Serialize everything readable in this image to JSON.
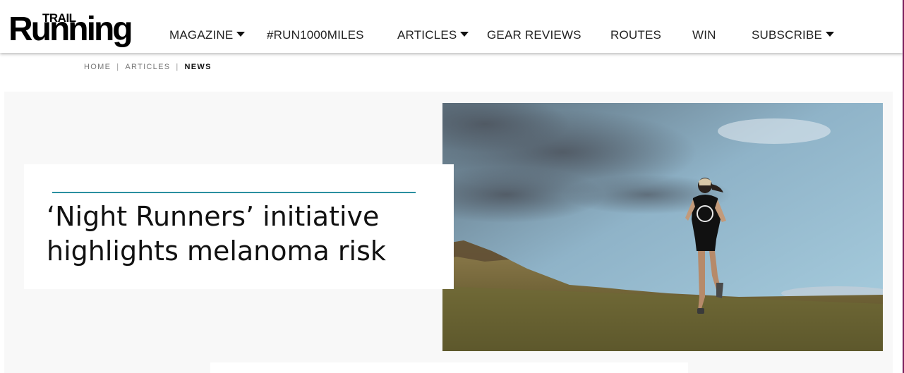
{
  "brand": {
    "logo_small": "TRAIL",
    "logo_large": "Running"
  },
  "nav": {
    "items": [
      {
        "label": "MAGAZINE",
        "dropdown": true
      },
      {
        "label": "#RUN1000MILES",
        "dropdown": false
      },
      {
        "label": "ARTICLES",
        "dropdown": true
      },
      {
        "label": "GEAR REVIEWS",
        "dropdown": false
      },
      {
        "label": "ROUTES",
        "dropdown": false
      },
      {
        "label": "WIN",
        "dropdown": false
      },
      {
        "label": "SUBSCRIBE",
        "dropdown": true
      }
    ]
  },
  "breadcrumb": {
    "home": "HOME",
    "separator": "|",
    "articles": "ARTICLES",
    "current": "NEWS"
  },
  "article": {
    "title": "‘Night Runners’ initiative highlights melanoma risk",
    "image_alt": "Runner wearing a The Night Runners t-shirt on a grassy hillside"
  },
  "colors": {
    "accent_rule": "#2a8fa0",
    "edge_bar": "#7a1f5c"
  }
}
